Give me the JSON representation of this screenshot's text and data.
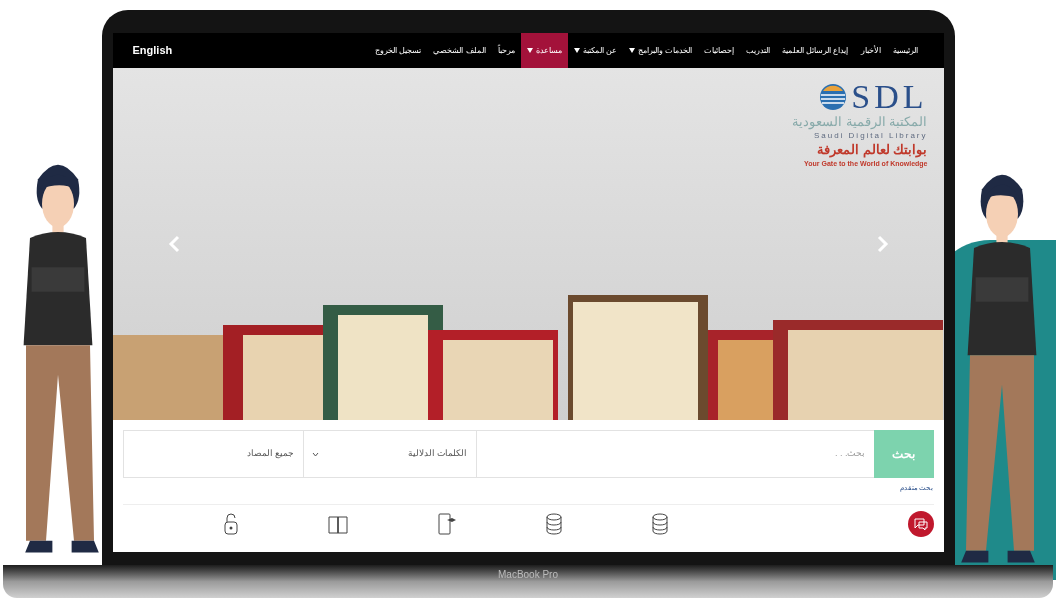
{
  "nav": {
    "language": "English",
    "items": [
      {
        "label": "الرئيسية",
        "selected": false,
        "dropdown": false
      },
      {
        "label": "الأخبار",
        "selected": false,
        "dropdown": false
      },
      {
        "label": "إيداع الرسائل العلمية",
        "selected": false,
        "dropdown": false
      },
      {
        "label": "التدريب",
        "selected": false,
        "dropdown": false
      },
      {
        "label": "إحصائيات",
        "selected": false,
        "dropdown": false
      },
      {
        "label": "الخدمات والبرامج",
        "selected": false,
        "dropdown": true
      },
      {
        "label": "عن المكتبة",
        "selected": false,
        "dropdown": true
      },
      {
        "label": "مساعدة",
        "selected": true,
        "dropdown": true
      },
      {
        "label": "مرحباً",
        "selected": false,
        "dropdown": false
      },
      {
        "label": "الملف الشخصي",
        "selected": false,
        "dropdown": false
      },
      {
        "label": "تسجيل الخروج",
        "selected": false,
        "dropdown": false
      }
    ]
  },
  "logo": {
    "mark": "SDL",
    "name_ar": "المكتبة الرقمية السعودية",
    "name_en": "Saudi Digital Library",
    "tagline_ar": "بوابتك لعالم المعرفة",
    "tagline_en": "Your Gate to the World of Knowledge"
  },
  "search": {
    "button": "بحث",
    "placeholder": "بحث. . .",
    "field_select": "الكلمات الدلالية",
    "source_select": "جميع المصاد",
    "advanced_link": "بحث متقدم"
  },
  "laptop": {
    "label": "MacBook Pro"
  }
}
